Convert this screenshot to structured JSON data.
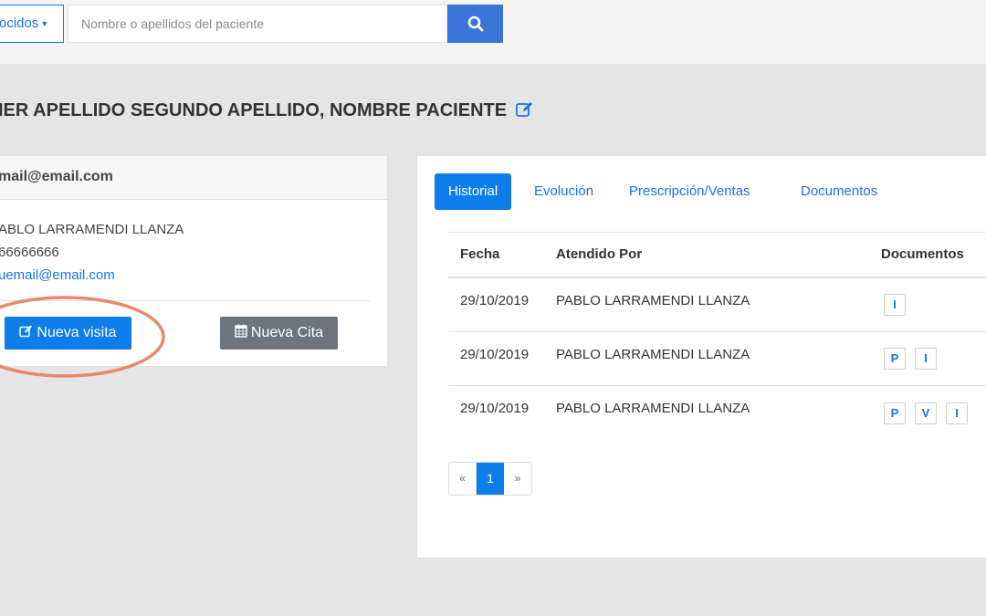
{
  "search": {
    "filter_label": "ocidos",
    "placeholder": "Nombre o apellidos del paciente"
  },
  "patient": {
    "title": "IER APELLIDO SEGUNDO APELLIDO, NOMBRE PACIENTE"
  },
  "contact_card": {
    "header": "mail@email.com",
    "name": "ABLO LARRAMENDI LLANZA",
    "phone": "66666666",
    "email": "uemail@email.com",
    "new_visit_label": "Nueva visita",
    "new_appointment_label": "Nueva Cita"
  },
  "history": {
    "tabs": [
      {
        "label": "Historial",
        "active": true
      },
      {
        "label": "Evolución",
        "active": false
      },
      {
        "label": "Prescripción/Ventas",
        "active": false
      },
      {
        "label": "Documentos",
        "active": false
      }
    ],
    "columns": [
      "Fecha",
      "Atendido Por",
      "Documentos"
    ],
    "rows": [
      {
        "date": "29/10/2019",
        "attended_by": "PABLO LARRAMENDI LLANZA",
        "documents": [
          "I"
        ]
      },
      {
        "date": "29/10/2019",
        "attended_by": "PABLO LARRAMENDI LLANZA",
        "documents": [
          "P",
          "I"
        ]
      },
      {
        "date": "29/10/2019",
        "attended_by": "PABLO LARRAMENDI LLANZA",
        "documents": [
          "P",
          "V",
          "I"
        ]
      }
    ],
    "pagination": {
      "prev": "«",
      "current": "1",
      "next": "»"
    }
  },
  "icons": {
    "search": "search-icon",
    "edit": "edit-icon",
    "calendar": "calendar-icon",
    "caret": "caret-down-icon"
  },
  "colors": {
    "primary": "#0d7dea",
    "search_button": "#3d74d8",
    "secondary_button": "#6c757d",
    "highlight": "#e8896a",
    "link": "#1a73e8"
  }
}
